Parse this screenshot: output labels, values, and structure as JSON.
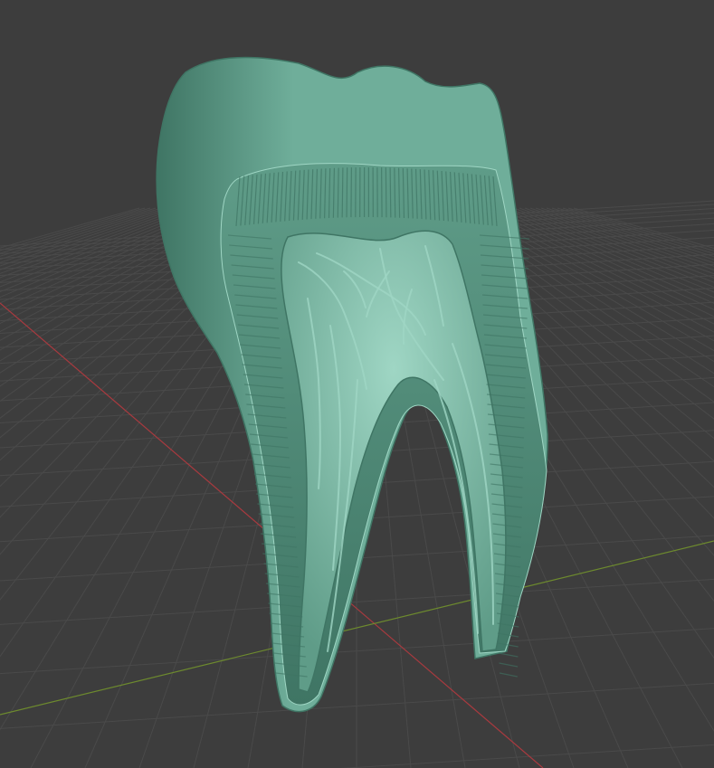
{
  "viewport": {
    "colors": {
      "background": "#3d3d3d",
      "grid_line": "#4a4a4a",
      "axis_x": "#a83a3f",
      "axis_y": "#6d8a2e",
      "model_base": "#6fae9a",
      "model_shadow": "#3f7564",
      "model_highlight": "#9fd6c4",
      "model_cut_face": "#5f9c88"
    },
    "object": {
      "icon": "molar-tooth-cross-section-model"
    }
  }
}
